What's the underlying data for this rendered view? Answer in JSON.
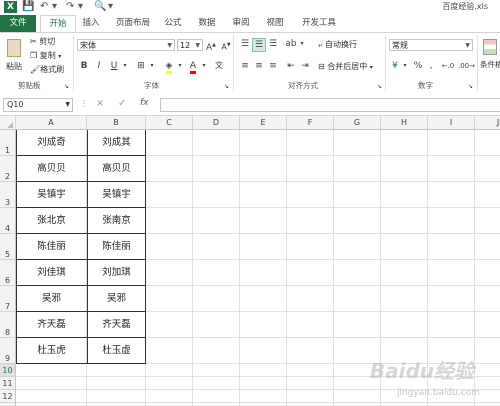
{
  "window": {
    "title": "百度经验.xls"
  },
  "tabs": [
    {
      "label": "文件"
    },
    {
      "label": "开始"
    },
    {
      "label": "插入"
    },
    {
      "label": "页面布局"
    },
    {
      "label": "公式"
    },
    {
      "label": "数据"
    },
    {
      "label": "审阅"
    },
    {
      "label": "视图"
    },
    {
      "label": "开发工具"
    }
  ],
  "ribbon": {
    "clipboard": {
      "paste": "粘贴",
      "cut": "剪切",
      "copy": "复制",
      "format_painter": "格式刷",
      "label": "剪贴板"
    },
    "font": {
      "name": "宋体",
      "size": "12",
      "label": "字体",
      "bold": "B",
      "italic": "I",
      "underline": "U",
      "grow": "A",
      "shrink": "A"
    },
    "alignment": {
      "wrap": "自动换行",
      "merge": "合并后居中",
      "label": "对齐方式"
    },
    "number": {
      "format": "常规",
      "label": "数字",
      "percent": "%",
      "comma": ",",
      "currency": "¥"
    },
    "styles": {
      "conditional": "条件格"
    }
  },
  "formula_bar": {
    "name_box": "Q10",
    "fx": "fx",
    "cancel": "×",
    "enter": "✓",
    "value": ""
  },
  "columns": [
    "A",
    "B",
    "C",
    "D",
    "E",
    "F",
    "G",
    "H",
    "I",
    "J"
  ],
  "rows": [
    "1",
    "2",
    "3",
    "4",
    "5",
    "6",
    "7",
    "8",
    "9",
    "10",
    "11",
    "12",
    "13"
  ],
  "selected_row": "10",
  "cells": [
    {
      "a": "刘成奇",
      "b": "刘成其"
    },
    {
      "a": "高贝贝",
      "b": "高贝贝"
    },
    {
      "a": "吴镇宇",
      "b": "吴镇宇"
    },
    {
      "a": "张北京",
      "b": "张南京"
    },
    {
      "a": "陈佳丽",
      "b": "陈佳丽"
    },
    {
      "a": "刘佳琪",
      "b": "刘加琪"
    },
    {
      "a": "吴邪",
      "b": "吴邪"
    },
    {
      "a": "齐天磊",
      "b": "齐天磊"
    },
    {
      "a": "杜玉虎",
      "b": "杜玉虚"
    }
  ],
  "watermark": {
    "brand": "Baidu经验",
    "url": "jingyan.baidu.com"
  }
}
